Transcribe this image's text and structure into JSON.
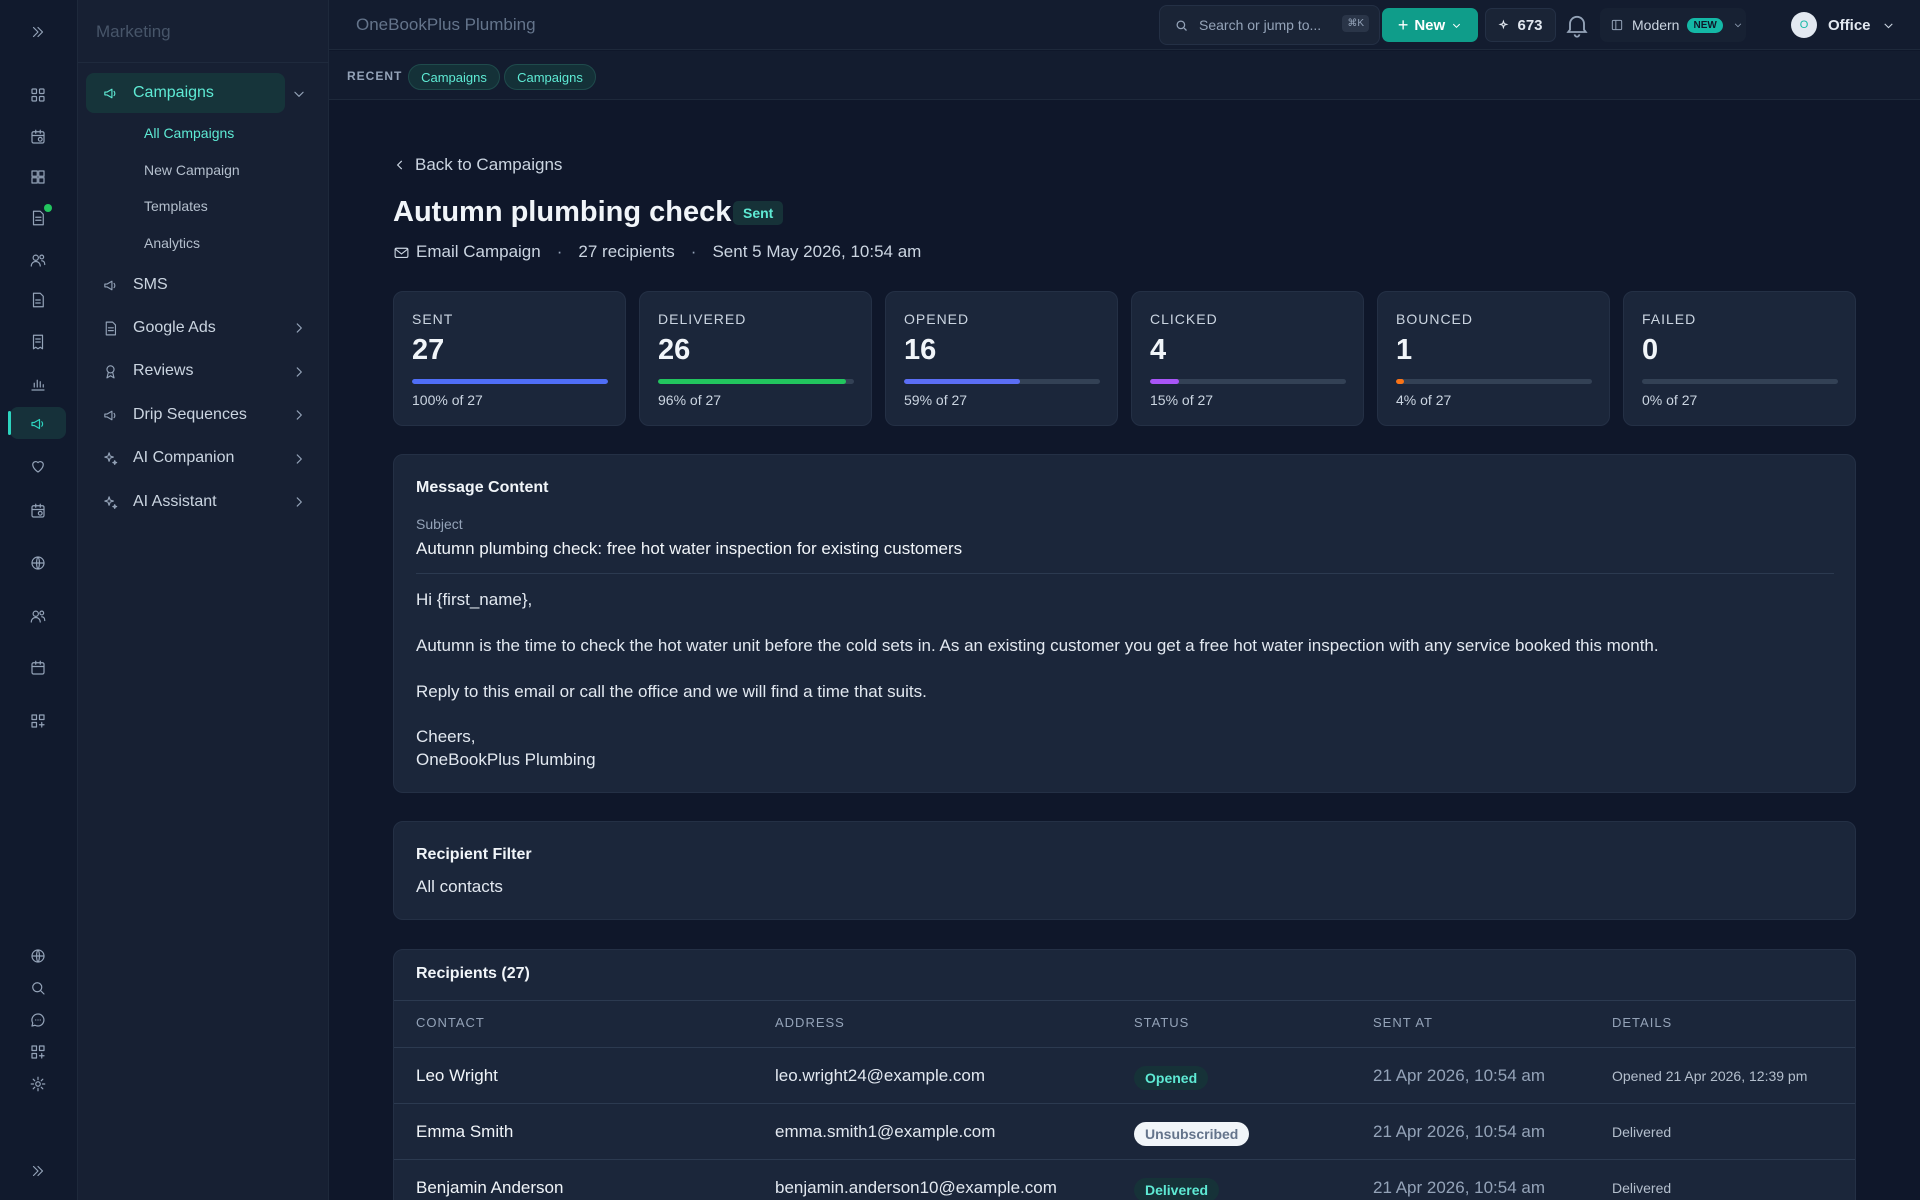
{
  "app": {
    "org_name": "OneBookPlus Plumbing",
    "section_title": "Marketing"
  },
  "topbar": {
    "search_placeholder": "Search or jump to...",
    "search_shortcut": "⌘K",
    "new_label": "New",
    "credits": "673",
    "mode_label": "Modern",
    "mode_badge": "NEW",
    "account_initial": "O",
    "account_label": "Office"
  },
  "recent": {
    "label": "RECENT",
    "chips": [
      "Campaigns",
      "Campaigns"
    ]
  },
  "rail_icons": [
    "expand-icon",
    "dashboard-icon",
    "calendar-icon",
    "apps-icon",
    "document-icon",
    "customers-icon",
    "invoice-icon",
    "receipt-icon",
    "reports-icon",
    "megaphone-icon",
    "heart-icon",
    "schedule-icon",
    "globe-icon",
    "team-icon",
    "calendar-icon",
    "integrations-icon",
    "globe-icon",
    "search-icon",
    "chat-icon",
    "apps-add-icon",
    "settings-icon",
    "collapse-icon"
  ],
  "sidebar": {
    "items": [
      {
        "label": "Campaigns",
        "icon": "megaphone-icon",
        "active": true,
        "expanded": true
      },
      {
        "label": "SMS",
        "icon": "megaphone-icon"
      },
      {
        "label": "Google Ads",
        "icon": "document-icon"
      },
      {
        "label": "Reviews",
        "icon": "award-icon"
      },
      {
        "label": "Drip Sequences",
        "icon": "megaphone-icon"
      },
      {
        "label": "AI Companion",
        "icon": "sparkle-icon"
      },
      {
        "label": "AI Assistant",
        "icon": "sparkle-icon"
      }
    ],
    "campaign_subitems": [
      "All Campaigns",
      "New Campaign",
      "Templates",
      "Analytics"
    ]
  },
  "campaign": {
    "back_label": "Back to Campaigns",
    "title": "Autumn plumbing check",
    "status": "Sent",
    "type": "Email Campaign",
    "recipients": "27 recipients",
    "sent_at": "Sent 5 May 2026, 10:54 am"
  },
  "stats": [
    {
      "label": "SENT",
      "value": "27",
      "percent_text": "100% of 27",
      "fraction": 1.0,
      "color": "#4f6ef7"
    },
    {
      "label": "DELIVERED",
      "value": "26",
      "percent_text": "96% of 27",
      "fraction": 0.96,
      "color": "#22c55e"
    },
    {
      "label": "OPENED",
      "value": "16",
      "percent_text": "59% of 27",
      "fraction": 0.59,
      "color": "#5b6ef5"
    },
    {
      "label": "CLICKED",
      "value": "4",
      "percent_text": "15% of 27",
      "fraction": 0.15,
      "color": "#a855f7"
    },
    {
      "label": "BOUNCED",
      "value": "1",
      "percent_text": "4% of 27",
      "fraction": 0.04,
      "color": "#f97316"
    },
    {
      "label": "FAILED",
      "value": "0",
      "percent_text": "0% of 27",
      "fraction": 0.0,
      "color": "#ef4444"
    }
  ],
  "message": {
    "heading": "Message Content",
    "subject_label": "Subject",
    "subject": "Autumn plumbing check: free hot water inspection for existing customers",
    "greeting": "Hi {first_name},",
    "body1": "Autumn is the time to check the hot water unit before the cold sets in. As an existing customer you get a free hot water inspection with any service booked this month.",
    "body2": "Reply to this email or call the office and we will find a time that suits.",
    "signoff": "Cheers,",
    "signature": "OneBookPlus Plumbing"
  },
  "filter": {
    "heading": "Recipient Filter",
    "value": "All contacts"
  },
  "recipients": {
    "heading": "Recipients (27)",
    "columns": [
      "CONTACT",
      "ADDRESS",
      "STATUS",
      "SENT AT",
      "DETAILS"
    ],
    "rows": [
      {
        "name": "Leo Wright",
        "address": "leo.wright24@example.com",
        "status": "Opened",
        "sent_at": "21 Apr 2026, 10:54 am",
        "details": "Opened 21 Apr 2026, 12:39 pm"
      },
      {
        "name": "Emma Smith",
        "address": "emma.smith1@example.com",
        "status": "Unsubscribed",
        "sent_at": "21 Apr 2026, 10:54 am",
        "details": "Delivered"
      },
      {
        "name": "Benjamin Anderson",
        "address": "benjamin.anderson10@example.com",
        "status": "Delivered",
        "sent_at": "21 Apr 2026, 10:54 am",
        "details": "Delivered"
      }
    ]
  }
}
